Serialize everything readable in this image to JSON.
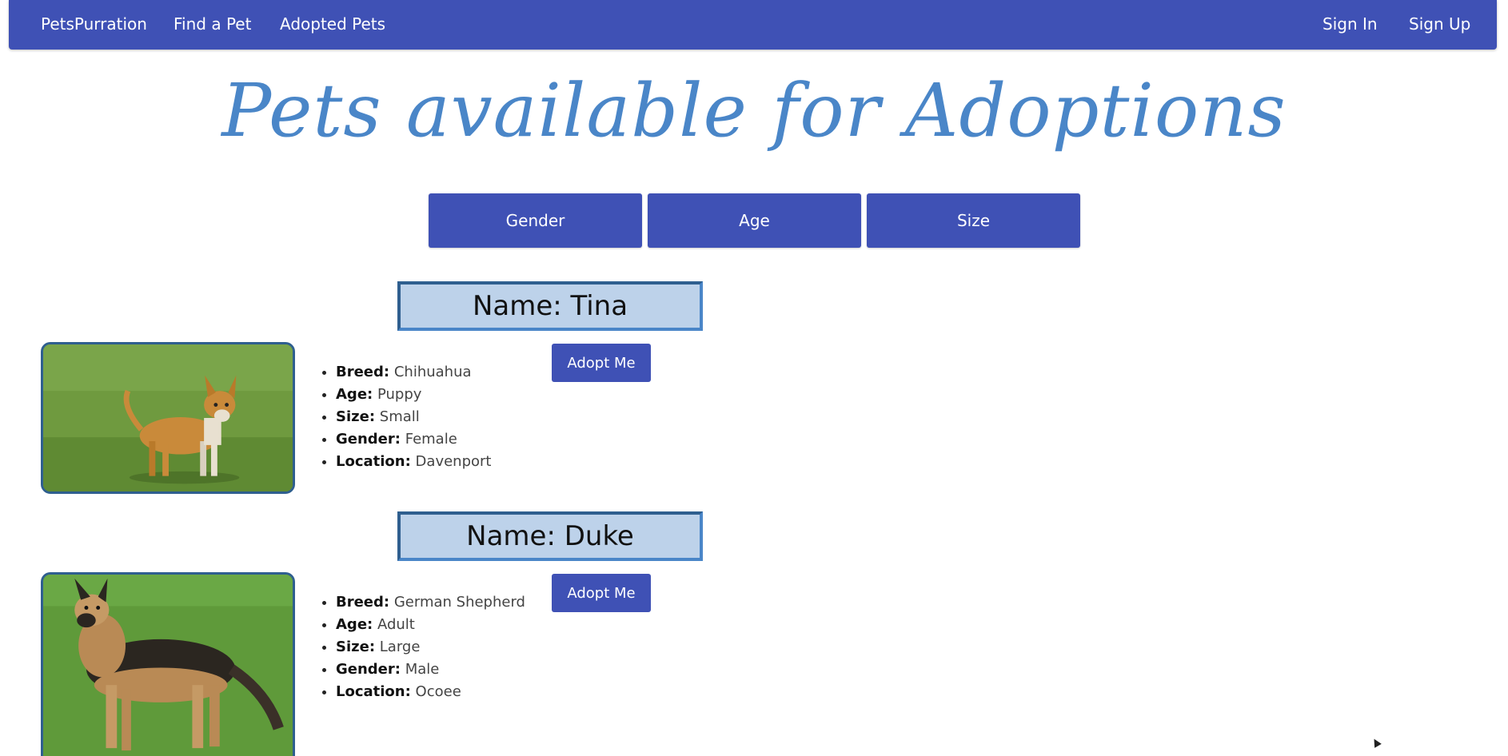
{
  "navbar": {
    "brand": "PetsPurration",
    "links": [
      "Find a Pet",
      "Adopted Pets"
    ],
    "sign_in": "Sign In",
    "sign_up": "Sign Up"
  },
  "page_title": "Pets available for Adoptions",
  "filters": [
    "Gender",
    "Age",
    "Size"
  ],
  "pets": [
    {
      "name": "Name: Tina",
      "adopt_label": "Adopt Me",
      "details": [
        {
          "label": "Breed:",
          "value": "Chihuahua"
        },
        {
          "label": "Age:",
          "value": "Puppy"
        },
        {
          "label": "Size:",
          "value": "Small"
        },
        {
          "label": "Gender:",
          "value": "Female"
        },
        {
          "label": "Location:",
          "value": "Davenport"
        }
      ]
    },
    {
      "name": "Name: Duke",
      "adopt_label": "Adopt Me",
      "details": [
        {
          "label": "Breed:",
          "value": "German Shepherd"
        },
        {
          "label": "Age:",
          "value": "Adult"
        },
        {
          "label": "Size:",
          "value": "Large"
        },
        {
          "label": "Gender:",
          "value": "Male"
        },
        {
          "label": "Location:",
          "value": "Ocoee"
        }
      ]
    }
  ],
  "colors": {
    "primary": "#3f51b5",
    "title": "#4a86c8",
    "name_box_bg": "#bdd2ea",
    "border": "#2f5f8f"
  }
}
